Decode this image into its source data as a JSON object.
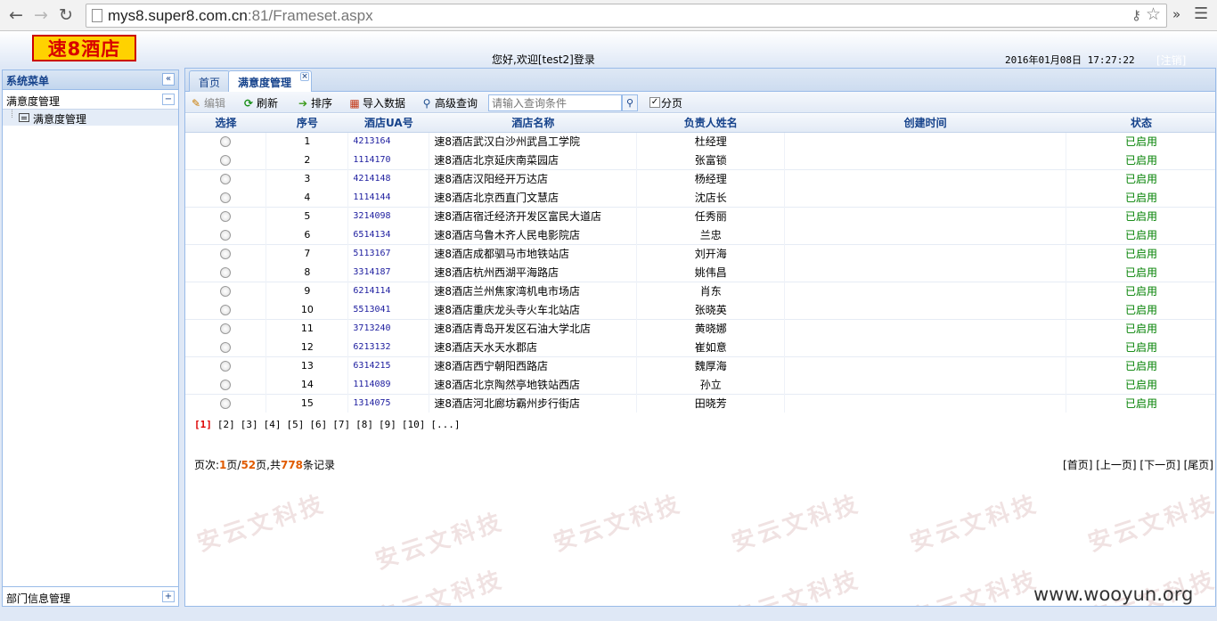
{
  "browser": {
    "url_host": "mys8.super8.com.cn",
    "url_rest": ":81/Frameset.aspx"
  },
  "header": {
    "logo_text": "速8酒店",
    "welcome": "您好,欢迎[test2]登录",
    "datetime": "2016年01月08日 17:27:22",
    "logout": "[注销]"
  },
  "sidebar": {
    "title": "系统菜单",
    "section": "满意度管理",
    "item": "满意度管理",
    "bottom": "部门信息管理"
  },
  "tabs": [
    {
      "label": "首页"
    },
    {
      "label": "满意度管理"
    }
  ],
  "toolbar": {
    "edit": "编辑",
    "refresh": "刷新",
    "sort": "排序",
    "import": "导入数据",
    "advanced": "高级查询",
    "search_placeholder": "请输入查询条件",
    "paging": "分页"
  },
  "table": {
    "headers": [
      "选择",
      "序号",
      "酒店UA号",
      "酒店名称",
      "负责人姓名",
      "创建时间",
      "状态"
    ],
    "rows": [
      {
        "no": "1",
        "code": "4213164",
        "name": "速8酒店武汉白沙州武昌工学院",
        "manager": "杜经理",
        "created": "",
        "status": "已启用"
      },
      {
        "no": "2",
        "code": "1114170",
        "name": "速8酒店北京延庆南菜园店",
        "manager": "张富锁",
        "created": "",
        "status": "已启用"
      },
      {
        "no": "3",
        "code": "4214148",
        "name": "速8酒店汉阳经开万达店",
        "manager": "杨经理",
        "created": "",
        "status": "已启用"
      },
      {
        "no": "4",
        "code": "1114144",
        "name": "速8酒店北京西直门文慧店",
        "manager": "沈店长",
        "created": "",
        "status": "已启用"
      },
      {
        "no": "5",
        "code": "3214098",
        "name": "速8酒店宿迁经济开发区富民大道店",
        "manager": "任秀丽",
        "created": "",
        "status": "已启用"
      },
      {
        "no": "6",
        "code": "6514134",
        "name": "速8酒店乌鲁木齐人民电影院店",
        "manager": "兰忠",
        "created": "",
        "status": "已启用"
      },
      {
        "no": "7",
        "code": "5113167",
        "name": "速8酒店成都驷马市地铁站店",
        "manager": "刘开海",
        "created": "",
        "status": "已启用"
      },
      {
        "no": "8",
        "code": "3314187",
        "name": "速8酒店杭州西湖平海路店",
        "manager": "姚伟昌",
        "created": "",
        "status": "已启用"
      },
      {
        "no": "9",
        "code": "6214114",
        "name": "速8酒店兰州焦家湾机电市场店",
        "manager": "肖东",
        "created": "",
        "status": "已启用"
      },
      {
        "no": "10",
        "code": "5513041",
        "name": "速8酒店重庆龙头寺火车北站店",
        "manager": "张晓英",
        "created": "",
        "status": "已启用"
      },
      {
        "no": "11",
        "code": "3713240",
        "name": "速8酒店青岛开发区石油大学北店",
        "manager": "黄晓娜",
        "created": "",
        "status": "已启用"
      },
      {
        "no": "12",
        "code": "6213132",
        "name": "速8酒店天水天水郡店",
        "manager": "崔如意",
        "created": "",
        "status": "已启用"
      },
      {
        "no": "13",
        "code": "6314215",
        "name": "速8酒店西宁朝阳西路店",
        "manager": "魏厚海",
        "created": "",
        "status": "已启用"
      },
      {
        "no": "14",
        "code": "1114089",
        "name": "速8酒店北京陶然亭地铁站西店",
        "manager": "孙立",
        "created": "",
        "status": "已启用"
      },
      {
        "no": "15",
        "code": "1314075",
        "name": "速8酒店河北廊坊霸州步行街店",
        "manager": "田晓芳",
        "created": "",
        "status": "已启用"
      }
    ]
  },
  "pager": {
    "pages": [
      "[1]",
      "[2]",
      "[3]",
      "[4]",
      "[5]",
      "[6]",
      "[7]",
      "[8]",
      "[9]",
      "[10]",
      "[...]"
    ],
    "info_prefix": "页次:",
    "current": "1",
    "info_mid": "页/",
    "total_pages": "52",
    "info_mid2": "页,共",
    "total_records": "778",
    "info_suffix": "条记录",
    "first": "[首页]",
    "prev": "[上一页]",
    "next": "[下一页]",
    "last": "[尾页]"
  },
  "watermark": {
    "text": "安云文科技",
    "site": "www.wooyun.org"
  }
}
